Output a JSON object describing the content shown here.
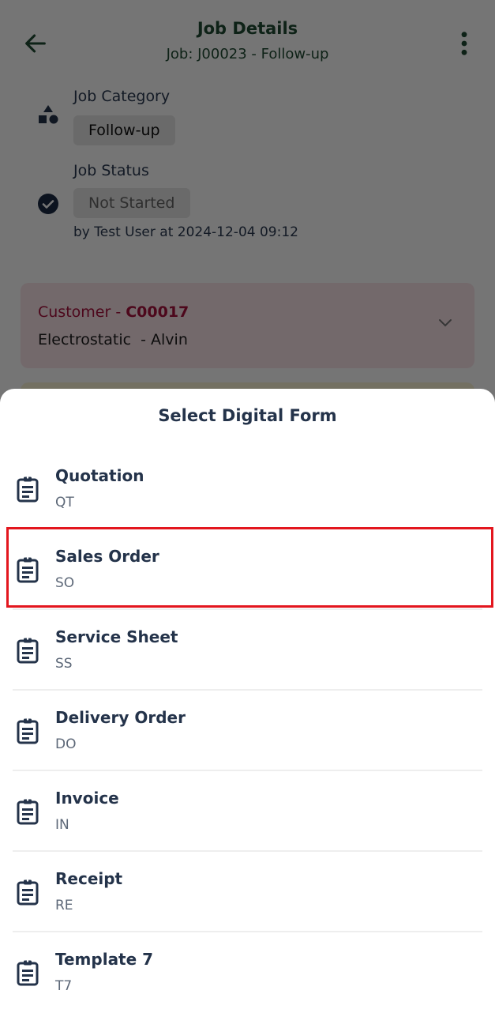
{
  "header": {
    "title": "Job Details",
    "subtitle": "Job: J00023 - Follow-up",
    "back_icon": "arrow-left-icon",
    "menu_icon": "more-vertical-icon"
  },
  "job_category": {
    "label": "Job Category",
    "value": "Follow-up",
    "icon": "shapes-icon"
  },
  "job_status": {
    "label": "Job Status",
    "value": "Not Started",
    "icon": "check-circle-icon",
    "updated_by": "by Test User at 2024-12-04 09:12"
  },
  "customer": {
    "label": "Customer",
    "separator": " - ",
    "code": "C00017",
    "name": "Electrostatic  - Alvin",
    "expand_icon": "chevron-down-icon"
  },
  "sheet": {
    "title": "Select Digital Form",
    "item_icon": "clipboard-icon",
    "items": [
      {
        "name": "Quotation",
        "code": "QT"
      },
      {
        "name": "Sales Order",
        "code": "SO"
      },
      {
        "name": "Service Sheet",
        "code": "SS"
      },
      {
        "name": "Delivery Order",
        "code": "DO"
      },
      {
        "name": "Invoice",
        "code": "IN"
      },
      {
        "name": "Receipt",
        "code": "RE"
      },
      {
        "name": "Template 7",
        "code": "T7"
      }
    ],
    "highlighted_index": 1
  },
  "colors": {
    "header_text": "#1f4a33",
    "customer_accent": "#a8123e",
    "customer_card_bg": "#fbe4ea",
    "sheet_text": "#24334a",
    "highlight_border": "#e3161e"
  }
}
